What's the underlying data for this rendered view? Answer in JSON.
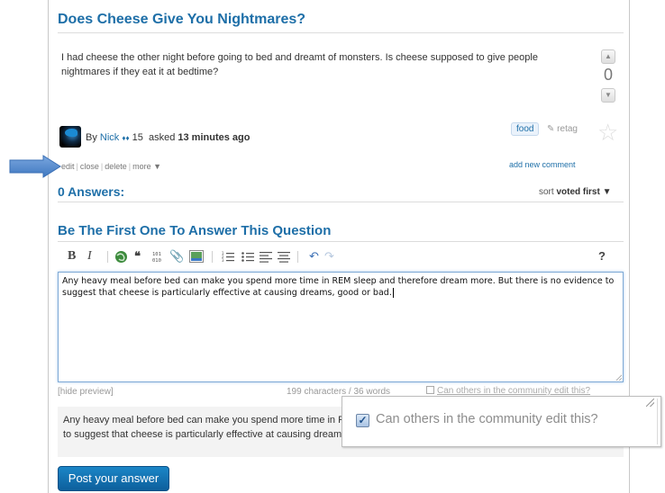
{
  "question": {
    "title": "Does Cheese Give You Nightmares?",
    "body": "I had cheese the other night before going to bed and dreamt of monsters. Is cheese supposed to give people nightmares if they eat it at bedtime?",
    "votes": "0",
    "author_prefix": "By",
    "author": "Nick",
    "author_badge": "♦♦",
    "author_rep": "15",
    "asked_label": "asked",
    "asked_time": "13 minutes ago",
    "tag": "food",
    "retag_label": "retag"
  },
  "post_actions": {
    "edit": "edit",
    "close": "close",
    "delete": "delete",
    "more": "more ▼",
    "add_comment": "add new comment"
  },
  "answers": {
    "heading": "0 Answers:",
    "sort_prefix": "sort",
    "sort_value": "voted first ▼"
  },
  "answer_form": {
    "heading": "Be The First One To Answer This Question",
    "editor_text": "Any heavy meal before bed can make you spend more time in REM sleep and therefore dream more. But there is no evidence to suggest that cheese is particularly effective at causing dreams, good or bad.",
    "hide_preview": "[hide preview]",
    "char_count": "199 characters / 36 words",
    "wiki_label": "Can others in the community edit this?",
    "preview_text": "Any heavy meal before bed can make you spend more time in REM sleep and therefore dream more. But there is no evidence to suggest that cheese is particularly effective at causing dreams, good or bad.",
    "submit": "Post your answer"
  },
  "toolbar": {
    "bold": "B",
    "italic": "I",
    "quote": "❝",
    "code": "101\n010",
    "help": "?"
  },
  "zoom_callout": {
    "checked": true,
    "label": "Can others in the community edit this?"
  },
  "colors": {
    "link_blue": "#1e6fa8",
    "button_blue": "#1577b8",
    "arrow_blue": "#5b8fd0"
  }
}
